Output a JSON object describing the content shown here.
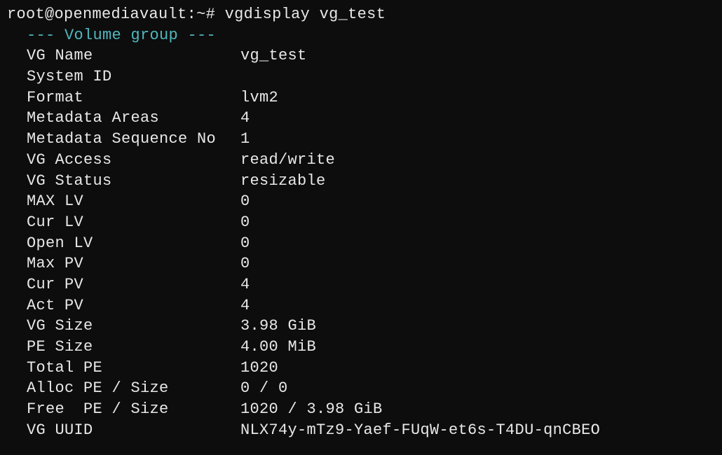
{
  "prompt": {
    "full": "root@openmediavault:~# vgdisplay vg_test",
    "user": "root",
    "host": "openmediavault",
    "path": "~",
    "symbol": "#",
    "command": "vgdisplay vg_test"
  },
  "section_header": "--- Volume group ---",
  "rows": [
    {
      "label": "VG Name",
      "value": "vg_test"
    },
    {
      "label": "System ID",
      "value": ""
    },
    {
      "label": "Format",
      "value": "lvm2"
    },
    {
      "label": "Metadata Areas",
      "value": "4"
    },
    {
      "label": "Metadata Sequence No",
      "value": "1"
    },
    {
      "label": "VG Access",
      "value": "read/write"
    },
    {
      "label": "VG Status",
      "value": "resizable"
    },
    {
      "label": "MAX LV",
      "value": "0"
    },
    {
      "label": "Cur LV",
      "value": "0"
    },
    {
      "label": "Open LV",
      "value": "0"
    },
    {
      "label": "Max PV",
      "value": "0"
    },
    {
      "label": "Cur PV",
      "value": "4"
    },
    {
      "label": "Act PV",
      "value": "4"
    },
    {
      "label": "VG Size",
      "value": "3.98 GiB"
    },
    {
      "label": "PE Size",
      "value": "4.00 MiB"
    },
    {
      "label": "Total PE",
      "value": "1020"
    },
    {
      "label": "Alloc PE / Size",
      "value": "0 / 0"
    },
    {
      "label": "Free  PE / Size",
      "value": "1020 / 3.98 GiB"
    },
    {
      "label": "VG UUID",
      "value": "NLX74y-mTz9-Yaef-FUqW-et6s-T4DU-qnCBEO"
    }
  ]
}
